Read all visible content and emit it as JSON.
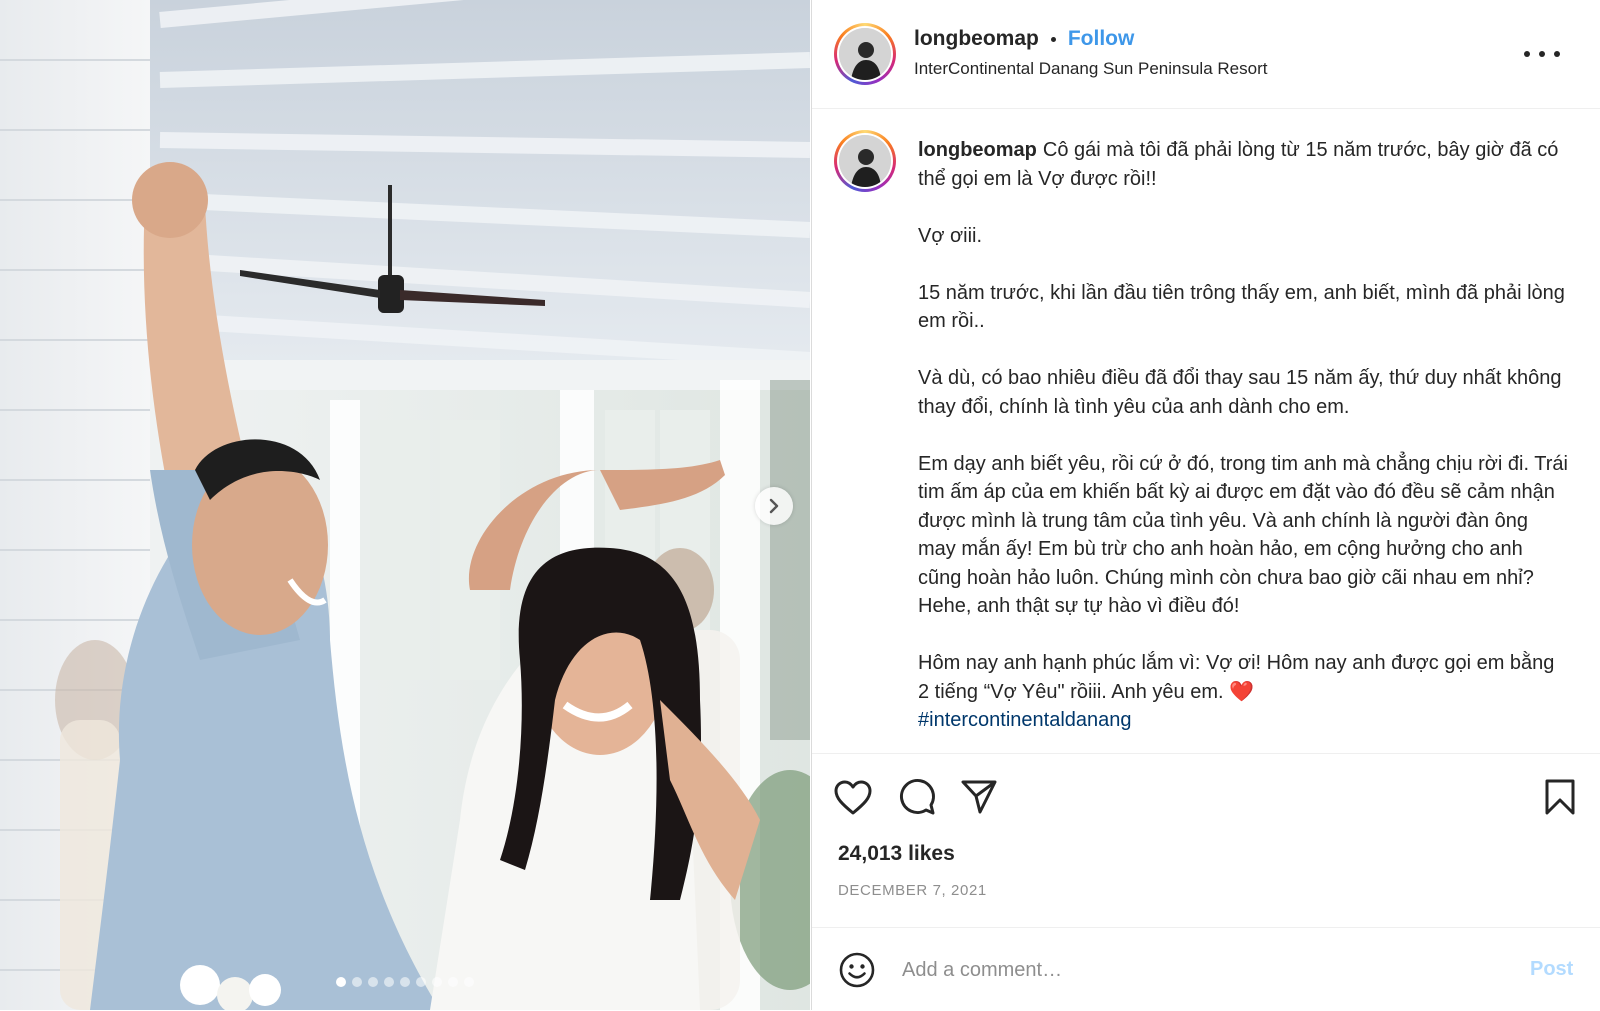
{
  "post": {
    "username": "longbeomap",
    "follow_label": "Follow",
    "location": "InterContinental Danang Sun Peninsula Resort",
    "caption_paragraphs": [
      "Cô gái mà tôi đã phải lòng từ 15 năm trước, bây giờ đã có thể gọi em là Vợ được rồi!!",
      "Vợ ơiii.",
      "15 năm trước, khi lần đầu tiên trông thấy em, anh biết, mình đã phải lòng em rồi..",
      "Và dù, có bao nhiêu điều đã đổi thay sau 15 năm ấy, thứ duy nhất không thay đổi, chính là tình yêu của anh dành cho em.",
      "Em dạy anh biết yêu, rồi cứ ở đó, trong tim anh mà chẳng chịu rời đi. Trái tim ấm áp của em khiến bất kỳ ai được em đặt vào đó đều sẽ cảm nhận được mình là trung tâm của tình yêu. Và anh chính là người đàn ông may mắn ấy! Em bù trừ cho anh hoàn hảo, em cộng hưởng cho anh cũng hoàn hảo luôn. Chúng mình còn chưa bao giờ cãi nhau em nhỉ? Hehe, anh thật sự tự hào vì điều đó!"
    ],
    "last_paragraph": "Hôm nay anh hạnh phúc lắm vì: Vợ ơi! Hôm nay anh được gọi em bằng 2 tiếng “Vợ Yêu\" rồiii. Anh yêu em. ❤️",
    "hashtag": "#intercontinentaldanang",
    "likes": "24,013 likes",
    "date": "DECEMBER 7, 2021"
  },
  "comment": {
    "placeholder": "Add a comment…",
    "post_label": "Post"
  },
  "carousel": {
    "slide_count": 9,
    "active_index": 0
  },
  "colors": {
    "follow": "#3e97e9",
    "hashtag": "#00376b",
    "post_disabled": "#b3dbff",
    "muted": "#8e8e8e"
  },
  "icons": [
    "more-options-icon",
    "heart-icon",
    "comment-icon",
    "share-icon",
    "bookmark-icon",
    "emoji-icon",
    "chevron-right-icon"
  ]
}
